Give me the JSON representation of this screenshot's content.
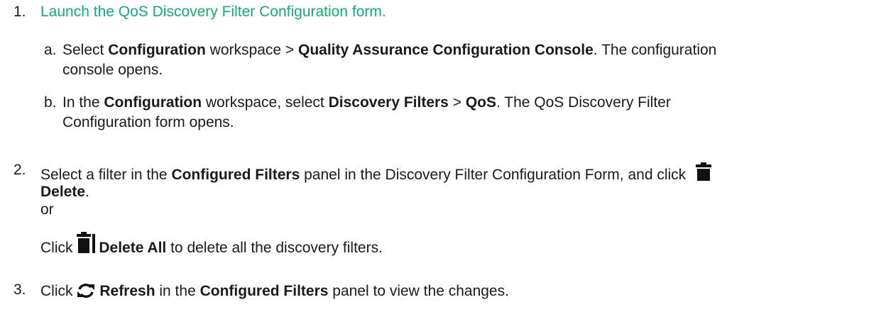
{
  "step1": {
    "number": "1.",
    "link": "Launch the QoS Discovery Filter Configuration form.",
    "a": {
      "letter": "a.",
      "t1": "Select ",
      "b1": "Configuration",
      "t2": " workspace > ",
      "b2": "Quality Assurance Configuration Console",
      "t3": ". The configuration",
      "t4": "console opens."
    },
    "b": {
      "letter": "b.",
      "t1": "In the ",
      "b1": "Configuration",
      "t2": " workspace, select ",
      "b2": "Discovery Filters",
      "t3": " > ",
      "b3": "QoS",
      "t4": ". The QoS Discovery Filter",
      "t5": "Configuration form opens."
    }
  },
  "step2": {
    "number": "2.",
    "t1": "Select a filter in the ",
    "b1": "Configured Filters",
    "t2": " panel in the Discovery Filter Configuration Form, and click",
    "icon1": "trash-icon",
    "b2": "Delete",
    "t3": ".",
    "or": "or",
    "t4": "Click ",
    "icon2": "trash-all-icon",
    "b3": "Delete All",
    "t5": " to delete all the discovery filters."
  },
  "step3": {
    "number": "3.",
    "t1": "Click ",
    "icon": "refresh-icon",
    "b1": "Refresh",
    "t2": " in the ",
    "b2": "Configured Filters",
    "t3": " panel to view the changes."
  },
  "colors": {
    "link": "#16a878",
    "text": "#1a1a1a"
  }
}
